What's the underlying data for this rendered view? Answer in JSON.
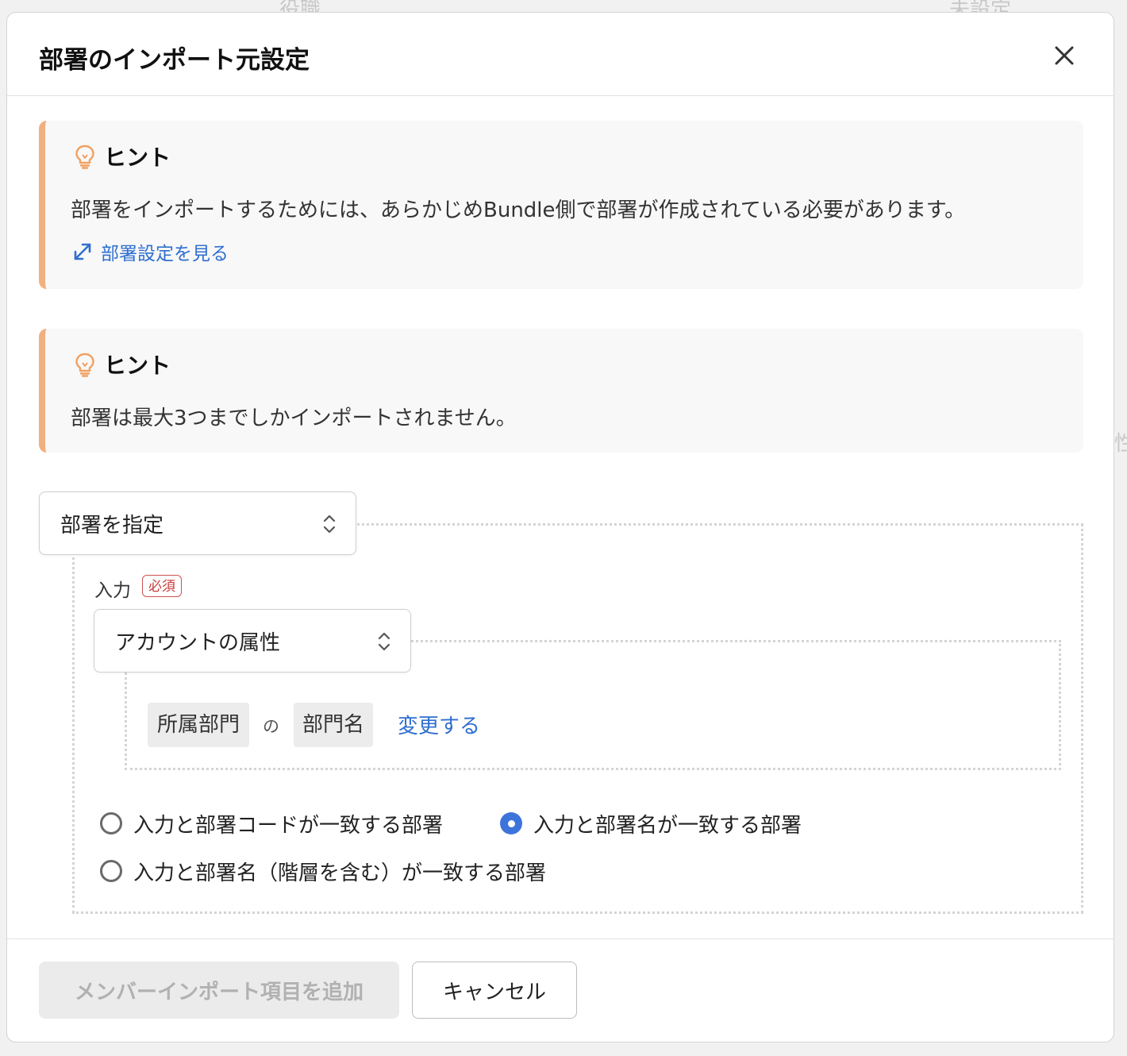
{
  "background": {
    "col1": "役職",
    "col2": "未設定",
    "edge": "性"
  },
  "modal": {
    "title": "部署のインポート元設定",
    "close_icon": "close-icon"
  },
  "hints": [
    {
      "title": "ヒント",
      "icon": "lightbulb-icon",
      "text": "部署をインポートするためには、あらかじめBundle側で部署が作成されている必要があります。",
      "link_label": "部署設定を見る",
      "link_icon": "external-link-icon"
    },
    {
      "title": "ヒント",
      "icon": "lightbulb-icon",
      "text": "部署は最大3つまでしかインポートされません。"
    }
  ],
  "department_select": {
    "value": "部署を指定"
  },
  "input_field": {
    "label": "入力",
    "required_badge": "必須",
    "select_value": "アカウントの属性",
    "attribute": {
      "category": "所属部門",
      "connector": "の",
      "field": "部門名",
      "change_link": "変更する"
    }
  },
  "match_options": {
    "selected": 1,
    "options": [
      "入力と部署コードが一致する部署",
      "入力と部署名が一致する部署",
      "入力と部署名（階層を含む）が一致する部署"
    ]
  },
  "footer": {
    "add_button": "メンバーインポート項目を追加",
    "cancel_button": "キャンセル"
  },
  "colors": {
    "accent": "#3d74db",
    "link": "#2f6fcf",
    "hint_border": "#f1b07e",
    "required": "#c63b3b"
  }
}
